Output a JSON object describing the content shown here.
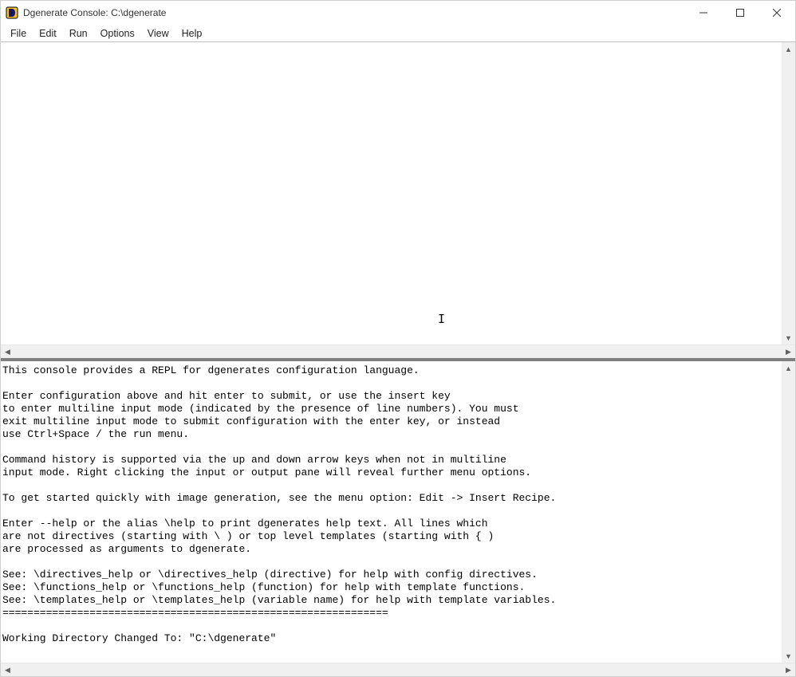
{
  "window": {
    "title": "Dgenerate Console: C:\\dgenerate"
  },
  "menu": {
    "items": [
      "File",
      "Edit",
      "Run",
      "Options",
      "View",
      "Help"
    ]
  },
  "console_output": "This console provides a REPL for dgenerates configuration language.\n\nEnter configuration above and hit enter to submit, or use the insert key\nto enter multiline input mode (indicated by the presence of line numbers). You must\nexit multiline input mode to submit configuration with the enter key, or instead\nuse Ctrl+Space / the run menu.\n\nCommand history is supported via the up and down arrow keys when not in multiline\ninput mode. Right clicking the input or output pane will reveal further menu options.\n\nTo get started quickly with image generation, see the menu option: Edit -> Insert Recipe.\n\nEnter --help or the alias \\help to print dgenerates help text. All lines which\nare not directives (starting with \\ ) or top level templates (starting with { )\nare processed as arguments to dgenerate.\n\nSee: \\directives_help or \\directives_help (directive) for help with config directives.\nSee: \\functions_help or \\functions_help (function) for help with template functions.\nSee: \\templates_help or \\templates_help (variable name) for help with template variables.\n==============================================================\n\nWorking Directory Changed To: \"C:\\dgenerate\""
}
